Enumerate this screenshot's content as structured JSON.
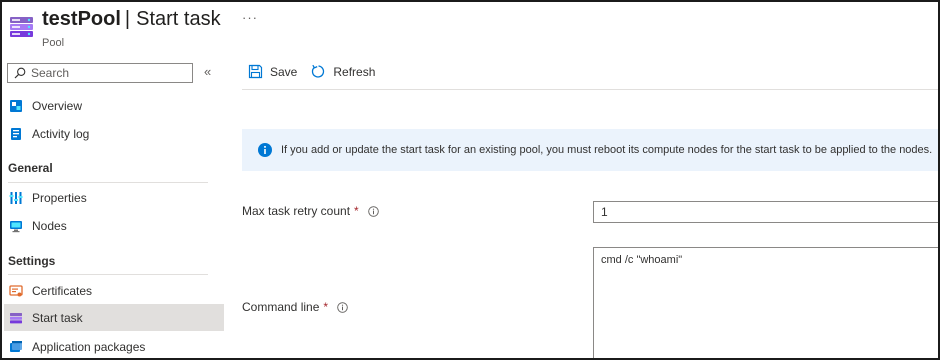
{
  "header": {
    "title_name": "testPool",
    "title_separator": "|",
    "title_page": "Start task",
    "subtitle": "Pool",
    "more_label": "···"
  },
  "sidebar": {
    "search_placeholder": "Search",
    "collapse_label": "«",
    "items_top": [
      {
        "label": "Overview",
        "icon": "overview-icon"
      },
      {
        "label": "Activity log",
        "icon": "activity-log-icon"
      }
    ],
    "sections": [
      {
        "title": "General",
        "items": [
          {
            "label": "Properties",
            "icon": "properties-icon"
          },
          {
            "label": "Nodes",
            "icon": "nodes-icon"
          }
        ]
      },
      {
        "title": "Settings",
        "items": [
          {
            "label": "Certificates",
            "icon": "certificates-icon"
          },
          {
            "label": "Start task",
            "icon": "start-task-icon",
            "active": true
          },
          {
            "label": "Application packages",
            "icon": "application-packages-icon"
          }
        ]
      }
    ]
  },
  "toolbar": {
    "save_label": "Save",
    "refresh_label": "Refresh"
  },
  "info_banner": {
    "text": "If you add or update the start task for an existing pool, you must reboot its compute nodes for the start task to be applied to the nodes."
  },
  "form": {
    "retry_label": "Max task retry count",
    "retry_required": "*",
    "retry_value": "1",
    "command_label": "Command line",
    "command_required": "*",
    "command_value": "cmd /c \"whoami\""
  },
  "colors": {
    "accent": "#0078d4",
    "active_nav_bg": "#e1dfdd",
    "banner_bg": "#ebf3fc",
    "required": "#a4262c"
  }
}
